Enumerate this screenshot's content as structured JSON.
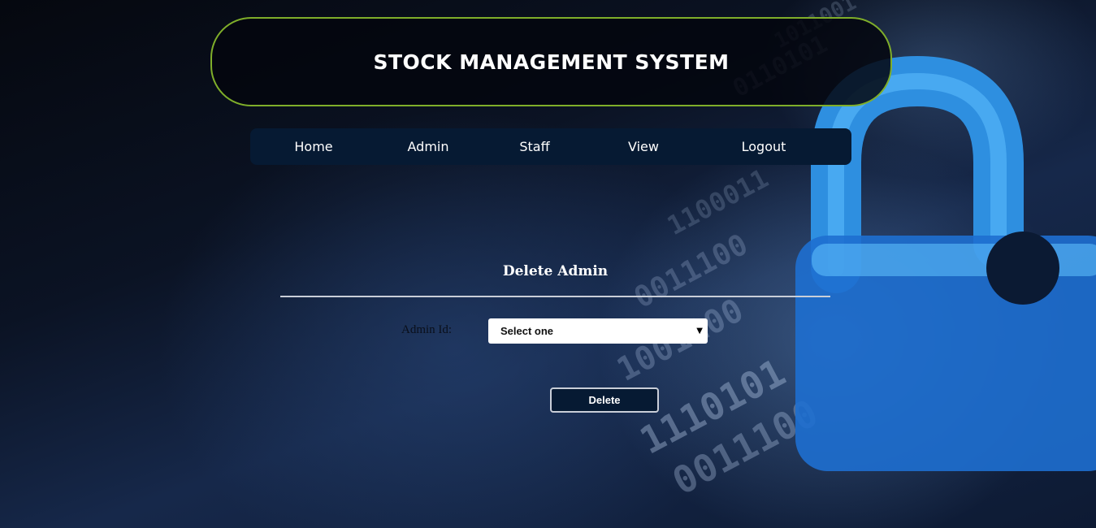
{
  "header": {
    "title": "STOCK MANAGEMENT SYSTEM",
    "border_color": "#7fae2a"
  },
  "nav": {
    "items": [
      {
        "label": "Home"
      },
      {
        "label": "Admin"
      },
      {
        "label": "Staff"
      },
      {
        "label": "View"
      },
      {
        "label": "Logout"
      }
    ],
    "background": "#061a33"
  },
  "form": {
    "title": "Delete Admin",
    "admin_id_label": "Admin Id:",
    "admin_id_selected": "Select one",
    "delete_button": "Delete"
  },
  "background": {
    "art_icon": "padlock-icon",
    "art_text": "binary digits"
  }
}
